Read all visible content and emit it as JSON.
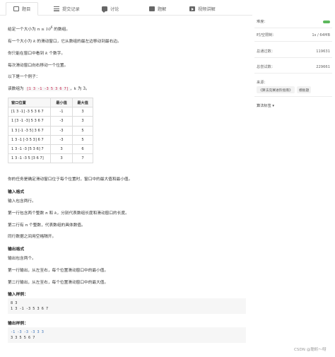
{
  "tabs": [
    {
      "label": "题目",
      "icon": "book-icon"
    },
    {
      "label": "提交记录",
      "icon": "list-icon"
    },
    {
      "label": "讨论",
      "icon": "chat-icon"
    },
    {
      "label": "题解",
      "icon": "solution-icon"
    },
    {
      "label": "视频讲解",
      "icon": "video-icon"
    }
  ],
  "problem": {
    "line1_a": "给定一个大小为 ",
    "line1_b": "n ≤ 10",
    "line1_sup": "6",
    "line1_c": " 的数组。",
    "line2_a": "有一个大小为 ",
    "line2_k": "k",
    "line2_b": " 的滑动窗口，它从数组的最左边移动到最右边。",
    "line3_a": "你只能在窗口中看到 ",
    "line3_k": "k",
    "line3_b": " 个数字。",
    "line4": "每次滑动窗口向右移动一个位置。",
    "line5": "以下是一个例子：",
    "line6_a": "该数组为 ",
    "line6_code": "[1 3 -1 -3 5 3 6 7]",
    "line6_b": "，",
    "line6_k": "k",
    "line6_c": " 为 3。",
    "table_headers": [
      "窗口位置",
      "最小值",
      "最大值"
    ],
    "table_rows": [
      [
        "[1 3 -1] -3 5 3 6 7",
        "-1",
        "3"
      ],
      [
        "1 [3 -1 -3] 5 3 6 7",
        "-3",
        "3"
      ],
      [
        "1 3 [-1 -3 5] 3 6 7",
        "-3",
        "5"
      ],
      [
        "1 3 -1 [-3 5 3] 6 7",
        "-3",
        "5"
      ],
      [
        "1 3 -1 -3 [5 3 6] 7",
        "3",
        "6"
      ],
      [
        "1 3 -1 -3 5 [3 6 7]",
        "3",
        "7"
      ]
    ],
    "task": "你的任务是确定滑动窗口位于每个位置时，窗口中的最大值和最小值。",
    "input_title": "输入格式",
    "input_1": "输入包含两行。",
    "input_2a": "第一行包含两个整数 ",
    "input_2n": "n",
    "input_2b": " 和 ",
    "input_2k": "k",
    "input_2c": "，分别代表数组长度和滑动窗口的长度。",
    "input_3a": "第二行有 ",
    "input_3n": "n",
    "input_3b": " 个整数，代表数组的具体数值。",
    "input_4": "同行数据之间用空格隔开。",
    "output_title": "输出格式",
    "output_1": "输出包含两个。",
    "output_2": "第一行输出，从左至右，每个位置滑动窗口中的最小值。",
    "output_3": "第二行输出，从左至右，每个位置滑动窗口中的最大值。",
    "sample_in_title": "输入样例：",
    "sample_in": "8 3\n1 3 -1 -3 5 3 6 7",
    "sample_out_title": "输出样例：",
    "sample_out_1": "-1 -3 -3 -3 3 3",
    "sample_out_2": "3 3 5 5 6 7"
  },
  "sidebar": {
    "difficulty_label": "难度：",
    "difficulty_value": "",
    "time_label": "时/空限制：",
    "time_value": "1s / 64MB",
    "passed_label": "总通过数：",
    "passed_value": "119631",
    "tried_label": "总尝试数：",
    "tried_value": "229661",
    "source_label": "来源：",
    "source_badges": [
      "《算法竞赛进阶指南》",
      "模板题"
    ],
    "tags_label": "算法标签 ▾"
  },
  "watermark": "CSDN @聪昕～呀",
  "colors": {
    "difficulty_dot": "#5cb85c",
    "code_inline": "#c7254e",
    "sample_out_1": "#3b73b9"
  }
}
